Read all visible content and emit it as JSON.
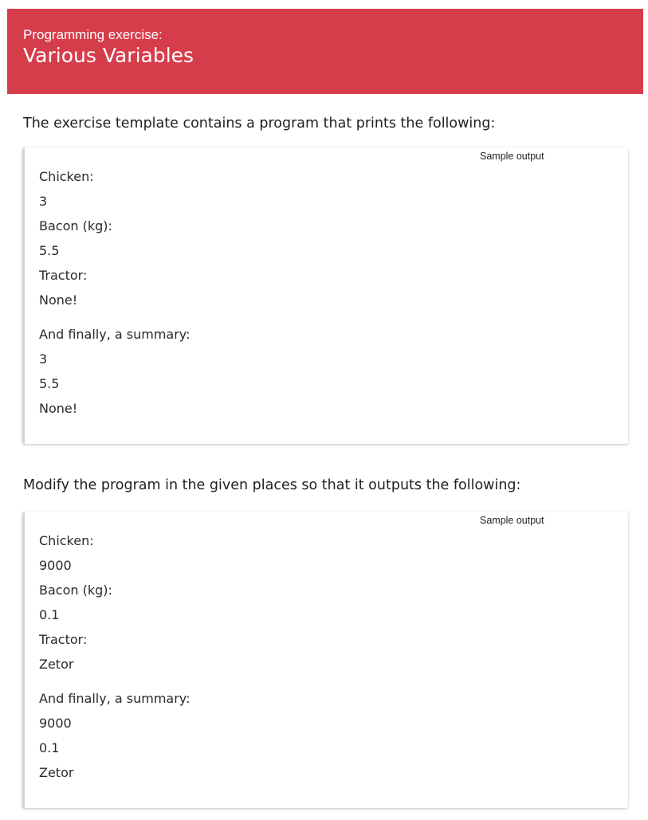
{
  "header": {
    "subtitle": "Programming exercise:",
    "title": "Various Variables"
  },
  "intro_text": "The exercise template contains a program that prints the following:",
  "sample_1": {
    "label": "Sample output",
    "lines": [
      "Chicken:",
      "3",
      "Bacon (kg):",
      "5.5",
      "Tractor:",
      "None!"
    ],
    "summary_lines": [
      "And finally, a summary:",
      "3",
      "5.5",
      "None!"
    ]
  },
  "modify_text": "Modify the program in the given places so that it outputs the following:",
  "sample_2": {
    "label": "Sample output",
    "lines": [
      "Chicken:",
      "9000",
      "Bacon (kg):",
      "0.1",
      "Tractor:",
      "Zetor"
    ],
    "summary_lines": [
      "And finally, a summary:",
      "9000",
      "0.1",
      "Zetor"
    ]
  }
}
